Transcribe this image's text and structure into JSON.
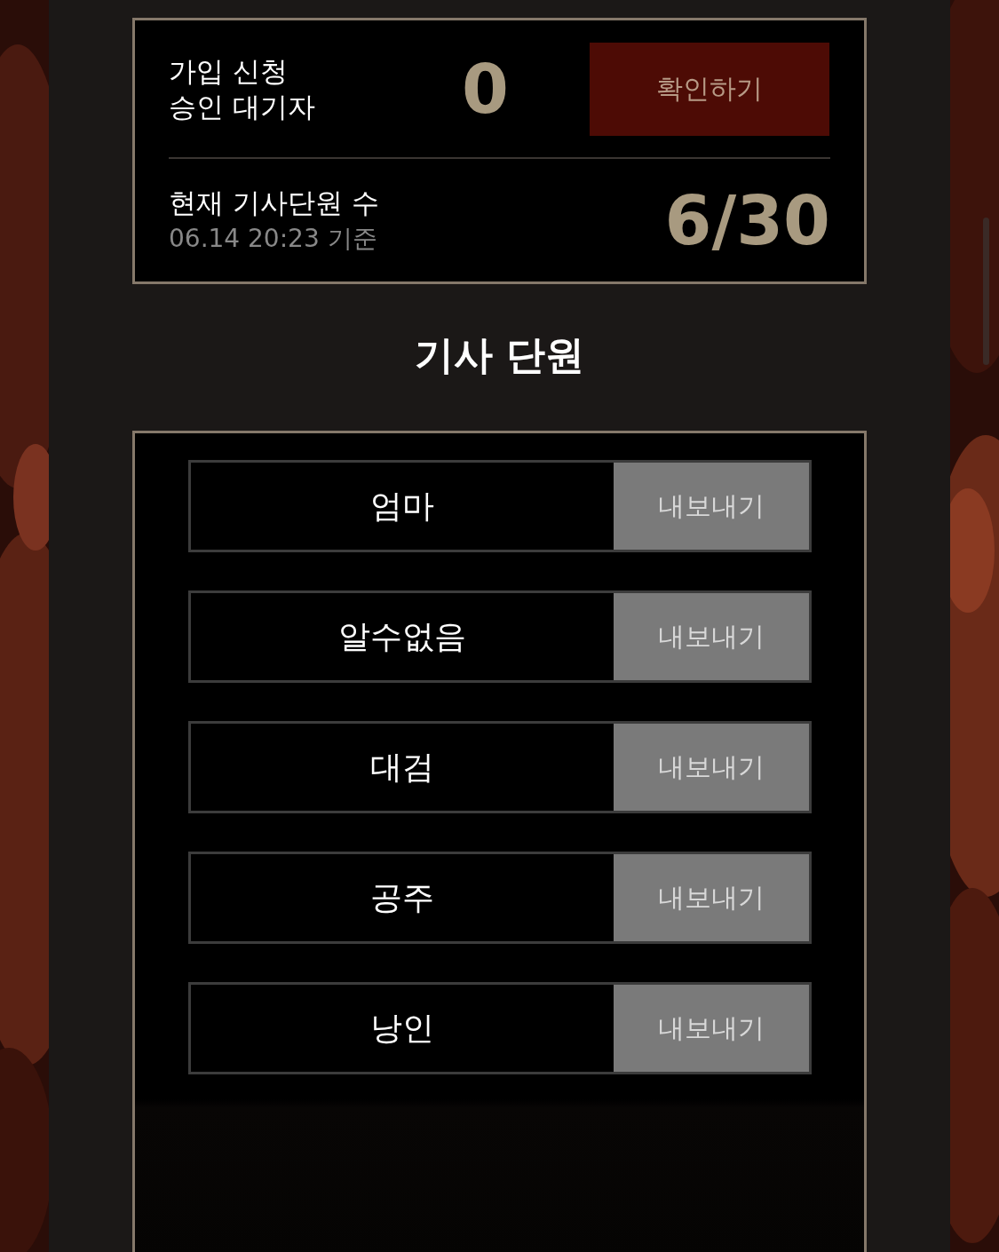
{
  "summary": {
    "pending_label": [
      "가입 신청",
      "승인 대기자"
    ],
    "pending_count": "0",
    "confirm_button": "확인하기",
    "members_label": "현재 기사단원 수",
    "timestamp": "06.14 20:23 기준",
    "members_count": "6/30"
  },
  "section_title": "기사 단원",
  "members": [
    {
      "name": "엄마",
      "action": "내보내기"
    },
    {
      "name": "알수없음",
      "action": "내보내기"
    },
    {
      "name": "대검",
      "action": "내보내기"
    },
    {
      "name": "공주",
      "action": "내보내기"
    },
    {
      "name": "낭인",
      "action": "내보내기"
    }
  ]
}
